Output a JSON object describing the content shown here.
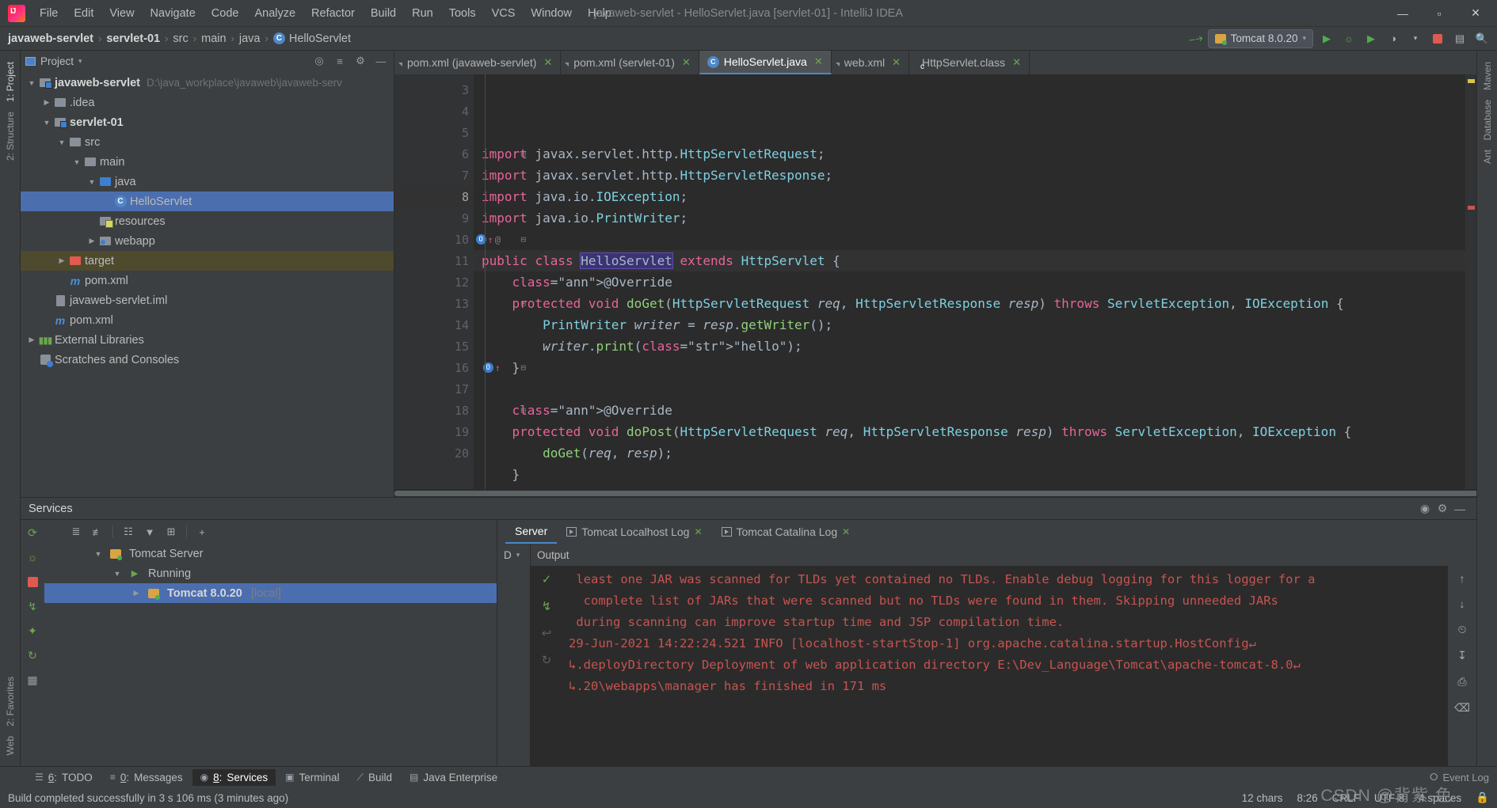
{
  "window": {
    "title": "javaweb-servlet - HelloServlet.java [servlet-01] - IntelliJ IDEA",
    "minimize": "—",
    "maximize": "▫",
    "close": "✕"
  },
  "menu": [
    "File",
    "Edit",
    "View",
    "Navigate",
    "Code",
    "Analyze",
    "Refactor",
    "Build",
    "Run",
    "Tools",
    "VCS",
    "Window",
    "Help"
  ],
  "breadcrumb": {
    "items": [
      "javaweb-servlet",
      "servlet-01",
      "src",
      "main",
      "java"
    ],
    "separator": "›",
    "file": "HelloServlet",
    "file_icon": "C"
  },
  "toolbar": {
    "build_icon": "build-hammer-icon",
    "run_config": "Tomcat 8.0.20",
    "chevron": "▾",
    "run_icon": "▶",
    "debug_icon": "🐞",
    "run2_icon": "▶",
    "coverage_icon": "◷",
    "stop_icon": "stop-square",
    "layout_icon": "▤",
    "search_icon": "🔍"
  },
  "project_panel": {
    "title": "Project",
    "chevron": "▾",
    "header_icons": [
      "locate-icon",
      "collapse-all-icon",
      "settings-gear-icon",
      "hide-icon"
    ],
    "tree": [
      {
        "depth": 0,
        "arrow": "▼",
        "icon": "module-folder",
        "label": "javaweb-servlet",
        "bold": true,
        "path": "D:\\java_workplace\\javaweb\\javaweb-serv"
      },
      {
        "depth": 1,
        "arrow": "▶",
        "icon": "folder",
        "label": ".idea",
        "bold": false,
        "path": ""
      },
      {
        "depth": 1,
        "arrow": "▼",
        "icon": "module-folder",
        "label": "servlet-01",
        "bold": true,
        "path": ""
      },
      {
        "depth": 2,
        "arrow": "▼",
        "icon": "folder",
        "label": "src",
        "bold": false,
        "path": ""
      },
      {
        "depth": 3,
        "arrow": "▼",
        "icon": "folder",
        "label": "main",
        "bold": false,
        "path": ""
      },
      {
        "depth": 4,
        "arrow": "▼",
        "icon": "source-folder",
        "label": "java",
        "bold": false,
        "path": ""
      },
      {
        "depth": 5,
        "arrow": "",
        "icon": "java-class",
        "label": "HelloServlet",
        "bold": false,
        "path": "",
        "selected": true
      },
      {
        "depth": 4,
        "arrow": "",
        "icon": "resource-folder",
        "label": "resources",
        "bold": false,
        "path": ""
      },
      {
        "depth": 4,
        "arrow": "▶",
        "icon": "web-folder",
        "label": "webapp",
        "bold": false,
        "path": ""
      },
      {
        "depth": 2,
        "arrow": "▶",
        "icon": "excluded-folder",
        "label": "target",
        "bold": false,
        "path": "",
        "highlight": true
      },
      {
        "depth": 2,
        "arrow": "",
        "icon": "maven",
        "label": "pom.xml",
        "bold": false,
        "path": ""
      },
      {
        "depth": 1,
        "arrow": "",
        "icon": "iml",
        "label": "javaweb-servlet.iml",
        "bold": false,
        "path": ""
      },
      {
        "depth": 1,
        "arrow": "",
        "icon": "maven",
        "label": "pom.xml",
        "bold": false,
        "path": ""
      },
      {
        "depth": 0,
        "arrow": "▶",
        "icon": "libraries",
        "label": "External Libraries",
        "bold": false,
        "path": ""
      },
      {
        "depth": 0,
        "arrow": "",
        "icon": "scratches",
        "label": "Scratches and Consoles",
        "bold": false,
        "path": ""
      }
    ]
  },
  "left_rail": {
    "top": [
      "1: Project",
      "2: Structure"
    ],
    "bottom": [
      "2: Favorites",
      "Web"
    ]
  },
  "right_rail": {
    "items": [
      "Maven",
      "Database",
      "Ant"
    ]
  },
  "editor": {
    "tabs": [
      {
        "label": "pom.xml (javaweb-servlet)",
        "icon": "xml-file-icon",
        "active": false,
        "close": "✕"
      },
      {
        "label": "pom.xml (servlet-01)",
        "icon": "xml-file-icon",
        "active": false,
        "close": "✕"
      },
      {
        "label": "HelloServlet.java",
        "icon": "java-class-icon",
        "active": true,
        "close": "✕"
      },
      {
        "label": "web.xml",
        "icon": "xml-file-icon",
        "active": false,
        "close": "✕"
      },
      {
        "label": "HttpServlet.class",
        "icon": "class-file-icon",
        "active": false,
        "close": "✕"
      }
    ],
    "first_line_number": 3,
    "lines": [
      {
        "n": 3,
        "text": "import javax.servlet.http.HttpServletRequest;"
      },
      {
        "n": 4,
        "text": "import javax.servlet.http.HttpServletResponse;"
      },
      {
        "n": 5,
        "text": "import java.io.IOException;"
      },
      {
        "n": 6,
        "text": "import java.io.PrintWriter;"
      },
      {
        "n": 7,
        "text": ""
      },
      {
        "n": 8,
        "text": "public class HelloServlet extends HttpServlet {"
      },
      {
        "n": 9,
        "text": "    @Override"
      },
      {
        "n": 10,
        "text": "    protected void doGet(HttpServletRequest req, HttpServletResponse resp) throws ServletException, IOException {"
      },
      {
        "n": 11,
        "text": "        PrintWriter writer = resp.getWriter();"
      },
      {
        "n": 12,
        "text": "        writer.print(\"hello\");"
      },
      {
        "n": 13,
        "text": "    }"
      },
      {
        "n": 14,
        "text": ""
      },
      {
        "n": 15,
        "text": "    @Override"
      },
      {
        "n": 16,
        "text": "    protected void doPost(HttpServletRequest req, HttpServletResponse resp) throws ServletException, IOException {"
      },
      {
        "n": 17,
        "text": "        doGet(req, resp);"
      },
      {
        "n": 18,
        "text": "    }"
      },
      {
        "n": 19,
        "text": "}"
      },
      {
        "n": 20,
        "text": ""
      }
    ],
    "current_line": 8,
    "gutter_markers": {
      "10": [
        "override-icon",
        "up-arrow-icon",
        "at-icon"
      ],
      "16": [
        "override-icon",
        "up-arrow-icon"
      ]
    }
  },
  "services": {
    "title": "Services",
    "header_icons": [
      "help-icon",
      "settings-gear-icon",
      "hide-icon"
    ],
    "toolbar_icons": [
      "rerun-icon",
      "expand-all-icon",
      "collapse-all-icon",
      "group-by-icon",
      "filter-icon",
      "add-tab-icon",
      "add-icon"
    ],
    "rail_icons": [
      "rerun-icon",
      "debug-icon",
      "stop-icon",
      "deploy-icon",
      "settings-icon",
      "refresh-icon",
      "grid-icon"
    ],
    "tree": [
      {
        "depth": 0,
        "arrow": "▼",
        "icon": "tomcat-icon",
        "label": "Tomcat Server",
        "bold": false
      },
      {
        "depth": 1,
        "arrow": "▼",
        "icon": "running-icon",
        "label": "Running",
        "bold": false
      },
      {
        "depth": 2,
        "arrow": "▶",
        "icon": "tomcat-running-icon",
        "label": "Tomcat 8.0.20",
        "suffix": "[local]",
        "bold": true,
        "selected": true
      }
    ],
    "tabs": [
      {
        "label": "Server",
        "active": true,
        "close": ""
      },
      {
        "label": "Tomcat Localhost Log",
        "active": false,
        "close": "✕",
        "icon": "log-icon"
      },
      {
        "label": "Tomcat Catalina Log",
        "active": false,
        "close": "✕",
        "icon": "log-icon"
      }
    ],
    "console_header": "Output",
    "console_selector": "D",
    "console_lines": [
      " least one JAR was scanned for TLDs yet contained no TLDs. Enable debug logging for this logger for a",
      "  complete list of JARs that were scanned but no TLDs were found in them. Skipping unneeded JARs",
      " during scanning can improve startup time and JSP compilation time.",
      "29-Jun-2021 14:22:24.521 INFO [localhost-startStop-1] org.apache.catalina.startup.HostConfig↵",
      "↳.deployDirectory Deployment of web application directory E:\\Dev_Language\\Tomcat\\apache-tomcat-8.0↵",
      "↳.20\\webapps\\manager has finished in 171 ms"
    ],
    "console_side_icons": [
      "check-icon",
      "rerun-icon",
      "prev-icon",
      "rerun2-icon"
    ],
    "console_rail_icons": [
      "scroll-up-icon",
      "scroll-down-icon",
      "soft-wrap-icon",
      "scroll-end-icon",
      "print-icon",
      "clear-icon"
    ]
  },
  "toolwindow_bar": {
    "items": [
      {
        "num": "6",
        "label": "TODO",
        "icon": "todo-icon",
        "active": false
      },
      {
        "num": "0",
        "label": "Messages",
        "icon": "messages-icon",
        "active": false
      },
      {
        "num": "8",
        "label": "Services",
        "icon": "services-icon",
        "active": true
      },
      {
        "num": "",
        "label": "Terminal",
        "icon": "terminal-icon",
        "active": false
      },
      {
        "num": "",
        "label": "Build",
        "icon": "build-icon",
        "active": false
      },
      {
        "num": "",
        "label": "Java Enterprise",
        "icon": "java-enterprise-icon",
        "active": false
      }
    ],
    "event_log": "Event Log",
    "event_log_icon": "⭘"
  },
  "statusbar": {
    "message": "Build completed successfully in 3 s 106 ms (3 minutes ago)",
    "chars": "12 chars",
    "caret": "8:26",
    "line_sep": "CRLF",
    "encoding": "UTF-8",
    "indent": "4 spaces",
    "lock_icon": "🔒"
  },
  "watermark": "CSDN @背紫-色",
  "colors": {
    "bg_chrome": "#3c3f41",
    "bg_editor": "#2b2b2b",
    "selection_blue": "#4b6eaf",
    "accent_blue": "#4a88c7",
    "green": "#6aa84f",
    "error_red": "#c75450",
    "keyword_orange": "#cc7832",
    "keyword_pink": "#e8649a",
    "type_cyan": "#7fd0e0",
    "string_green": "#6a8759"
  }
}
